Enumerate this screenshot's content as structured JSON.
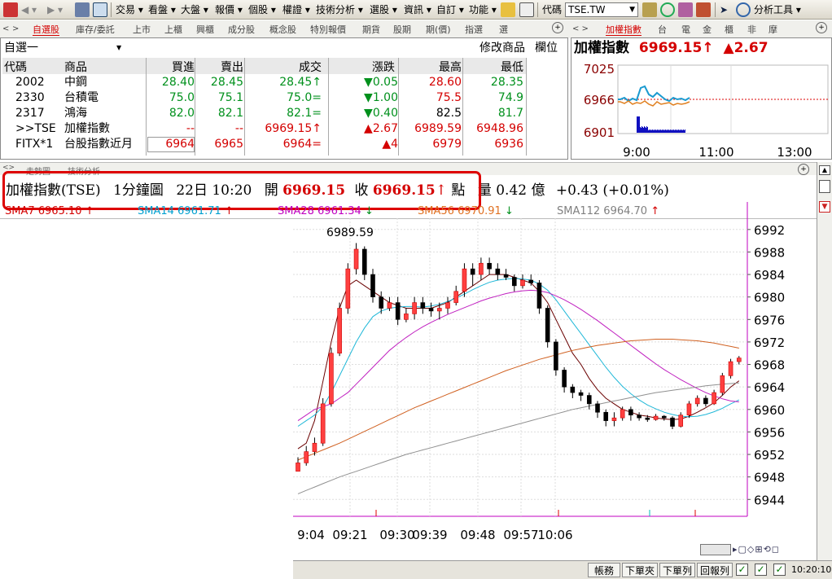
{
  "toolbar": {
    "items": [
      "交易",
      "看盤",
      "大盤",
      "報價",
      "個股",
      "權證",
      "技術分析",
      "選股",
      "資訊",
      "自訂",
      "功能"
    ],
    "code_label": "代碼",
    "code_value": "TSE.TW",
    "analysis_tools": "分析工具"
  },
  "quote_tabs": [
    "自選股",
    "庫存/委託",
    "上市",
    "上櫃",
    "興櫃",
    "成分股",
    "概念股",
    "特別報價",
    "期貨",
    "股期",
    "期(價)",
    "指選",
    "選"
  ],
  "quote_panel": {
    "group": "自選一",
    "modify_label": "修改商品",
    "column_label": "欄位",
    "headers": [
      "代碼",
      "商品",
      "買進",
      "賣出",
      "成交",
      "漲跌",
      "最高",
      "最低"
    ],
    "rows": [
      {
        "code": "2002",
        "name": "中鋼",
        "bid": "28.40",
        "ask": "28.45",
        "last": "28.45",
        "last_mark": "↑",
        "change": "0.05",
        "dir": "down",
        "high": "28.60",
        "low": "28.35",
        "color": "green"
      },
      {
        "code": "2330",
        "name": "台積電",
        "bid": "75.0",
        "ask": "75.1",
        "last": "75.0",
        "last_mark": "=",
        "change": "1.00",
        "dir": "down",
        "high": "75.5",
        "low": "74.9",
        "color": "green"
      },
      {
        "code": "2317",
        "name": "鴻海",
        "bid": "82.0",
        "ask": "82.1",
        "last": "82.1",
        "last_mark": "=",
        "change": "0.40",
        "dir": "down",
        "high": "82.5",
        "low": "81.7",
        "color": "green"
      },
      {
        "code": ">>TSE",
        "name": "加權指數",
        "bid": "--",
        "ask": "--",
        "last": "6969.15",
        "last_mark": "↑",
        "change": "2.67",
        "dir": "up",
        "high": "6989.59",
        "low": "6948.96",
        "color": "red"
      },
      {
        "code": "FITX*1",
        "name": "台股指數近月",
        "bid": "6964",
        "ask": "6965",
        "last": "6964",
        "last_mark": "=",
        "change": "4",
        "dir": "up",
        "high": "6979",
        "low": "6936",
        "color": "red"
      }
    ]
  },
  "mini_tabs": [
    "加權指數",
    "台",
    "電",
    "金",
    "櫃",
    "非",
    "摩"
  ],
  "mini_panel": {
    "title": "加權指數",
    "price": "6969.15",
    "arrow": "↑",
    "change": "▲2.67",
    "y_labels": [
      "7025",
      "6966",
      "6901"
    ],
    "x_labels": [
      "9:00",
      "11:00",
      "13:00"
    ]
  },
  "chart_tabs": [
    "走勢圖",
    "技術分析"
  ],
  "chart_header": {
    "name": "加權指數(TSE)",
    "period": "1分鐘圖",
    "date": "22日",
    "time": "10:20",
    "open_label": "開",
    "open": "6969.15",
    "close_label": "收",
    "close": "6969.15",
    "close_mark": "↑",
    "point_label": "點",
    "vol_label": "量",
    "vol": "0.42",
    "vol_unit": "億",
    "change_pct": "+0.43 (+0.01%)"
  },
  "sma": [
    {
      "name": "SMA7",
      "value": "6965.10",
      "dir": "↑",
      "color": "#d40000"
    },
    {
      "name": "SMA14",
      "value": "6961.71",
      "dir": "↑",
      "color": "#00a0d0"
    },
    {
      "name": "SMA28",
      "value": "6961.34",
      "dir": "↓",
      "color": "#c000c0"
    },
    {
      "name": "SMA56",
      "value": "6970.91",
      "dir": "↓",
      "color": "#e07020"
    },
    {
      "name": "SMA112",
      "value": "6964.70",
      "dir": "↑",
      "color": "#808080"
    }
  ],
  "chart_data": {
    "type": "candlestick",
    "annotation": "6989.59",
    "ylim": [
      6941,
      6994
    ],
    "y_ticks": [
      "6992",
      "6988",
      "6984",
      "6980",
      "6976",
      "6972",
      "6968",
      "6964",
      "6960",
      "6956",
      "6952",
      "6948",
      "6944"
    ],
    "x_ticks": [
      "9:04",
      "09:21",
      "09:30",
      "09:39",
      "09:48",
      "09:57",
      "10:06"
    ],
    "candles": [
      [
        6949.0,
        6950.5,
        6948.96,
        6951.5
      ],
      [
        6950.5,
        6952.5,
        6950.0,
        6953.5
      ],
      [
        6952.5,
        6954.0,
        6951.8,
        6955.0
      ],
      [
        6954.0,
        6961.0,
        6953.5,
        6962.0
      ],
      [
        6961.0,
        6970.0,
        6960.5,
        6971.0
      ],
      [
        6970.0,
        6978.0,
        6969.5,
        6979.0
      ],
      [
        6978.0,
        6985.0,
        6977.0,
        6986.0
      ],
      [
        6985.0,
        6988.5,
        6984.0,
        6989.59
      ],
      [
        6988.5,
        6984.0,
        6983.0,
        6989.0
      ],
      [
        6984.0,
        6980.0,
        6979.0,
        6985.0
      ],
      [
        6980.0,
        6978.0,
        6977.0,
        6981.0
      ],
      [
        6978.0,
        6979.0,
        6977.5,
        6980.0
      ],
      [
        6979.0,
        6976.0,
        6975.0,
        6980.0
      ],
      [
        6976.0,
        6977.0,
        6975.5,
        6978.0
      ],
      [
        6977.0,
        6979.0,
        6976.0,
        6980.0
      ],
      [
        6979.0,
        6978.0,
        6977.0,
        6980.0
      ],
      [
        6978.0,
        6977.5,
        6976.5,
        6979.0
      ],
      [
        6977.5,
        6978.0,
        6976.0,
        6979.0
      ],
      [
        6978.0,
        6979.0,
        6977.0,
        6980.0
      ],
      [
        6979.0,
        6981.0,
        6978.5,
        6982.0
      ],
      [
        6981.0,
        6985.0,
        6980.0,
        6986.0
      ],
      [
        6985.0,
        6984.0,
        6982.0,
        6986.0
      ],
      [
        6984.0,
        6986.0,
        6983.0,
        6987.0
      ],
      [
        6986.0,
        6985.0,
        6984.0,
        6987.0
      ],
      [
        6985.0,
        6984.0,
        6983.0,
        6986.0
      ],
      [
        6984.0,
        6983.5,
        6983.0,
        6985.0
      ],
      [
        6983.5,
        6982.0,
        6981.0,
        6984.0
      ],
      [
        6982.0,
        6983.0,
        6981.5,
        6984.0
      ],
      [
        6983.0,
        6982.5,
        6982.0,
        6984.0
      ],
      [
        6982.5,
        6978.0,
        6977.0,
        6983.0
      ],
      [
        6978.0,
        6972.0,
        6971.0,
        6978.5
      ],
      [
        6972.0,
        6967.0,
        6966.0,
        6972.5
      ],
      [
        6967.0,
        6964.0,
        6963.0,
        6967.5
      ],
      [
        6964.0,
        6963.0,
        6962.0,
        6964.5
      ],
      [
        6963.0,
        6962.5,
        6961.5,
        6963.5
      ],
      [
        6962.5,
        6961.0,
        6960.0,
        6963.0
      ],
      [
        6961.0,
        6959.5,
        6958.5,
        6961.5
      ],
      [
        6959.5,
        6958.0,
        6957.0,
        6960.0
      ],
      [
        6958.0,
        6958.5,
        6957.0,
        6959.5
      ],
      [
        6958.5,
        6960.0,
        6958.0,
        6960.5
      ],
      [
        6960.0,
        6959.0,
        6958.0,
        6960.5
      ],
      [
        6959.0,
        6958.5,
        6958.0,
        6959.5
      ],
      [
        6958.5,
        6958.2,
        6957.8,
        6959.0
      ],
      [
        6958.2,
        6958.8,
        6958.0,
        6959.2
      ],
      [
        6958.8,
        6958.5,
        6958.0,
        6959.0
      ],
      [
        6958.5,
        6957.0,
        6956.5,
        6958.8
      ],
      [
        6957.0,
        6959.0,
        6956.8,
        6959.5
      ],
      [
        6959.0,
        6961.0,
        6958.5,
        6961.5
      ],
      [
        6961.0,
        6962.0,
        6960.5,
        6962.5
      ],
      [
        6962.0,
        6961.0,
        6960.5,
        6962.5
      ],
      [
        6961.0,
        6963.0,
        6960.8,
        6963.5
      ],
      [
        6963.0,
        6966.0,
        6962.5,
        6966.5
      ],
      [
        6966.0,
        6968.5,
        6965.5,
        6969.0
      ],
      [
        6968.5,
        6969.15,
        6968.0,
        6969.5
      ]
    ],
    "sma_curves": {
      "SMA7": [
        6953,
        6954,
        6958,
        6965,
        6972,
        6978,
        6982,
        6983,
        6982,
        6981,
        6980,
        6979,
        6978.5,
        6978,
        6978,
        6978,
        6978,
        6978.5,
        6979,
        6980,
        6981,
        6982,
        6983,
        6984,
        6984,
        6984,
        6983.5,
        6983,
        6982.5,
        6981,
        6979,
        6976,
        6973,
        6970,
        6968,
        6965.5,
        6963.5,
        6962,
        6961,
        6960,
        6959.5,
        6959,
        6958.8,
        6958.5,
        6958.3,
        6958.2,
        6958.3,
        6958.8,
        6959.5,
        6960.3,
        6961.2,
        6962.5,
        6964,
        6965.1
      ],
      "SMA14": [
        6957,
        6958,
        6959,
        6960.5,
        6963,
        6966,
        6969,
        6972,
        6974.5,
        6976.5,
        6977.5,
        6978,
        6978.2,
        6978.3,
        6978.3,
        6978.2,
        6978.4,
        6978.7,
        6979.2,
        6979.8,
        6980.5,
        6981.3,
        6982,
        6982.6,
        6983,
        6983.2,
        6983.3,
        6983.2,
        6983,
        6982.3,
        6981.2,
        6979.5,
        6977.5,
        6975.5,
        6973.5,
        6971.5,
        6969.5,
        6967.5,
        6965.7,
        6964.1,
        6962.8,
        6961.7,
        6960.8,
        6960.1,
        6959.5,
        6959.1,
        6958.8,
        6958.7,
        6958.8,
        6959.1,
        6959.6,
        6960.2,
        6961,
        6961.7
      ],
      "SMA28": [
        6958,
        6959,
        6960,
        6960.5,
        6961,
        6962,
        6963,
        6964.5,
        6966,
        6967.5,
        6969,
        6970.5,
        6971.7,
        6972.8,
        6973.8,
        6974.7,
        6975.5,
        6976.2,
        6976.9,
        6977.5,
        6978.1,
        6978.7,
        6979.3,
        6979.8,
        6980.2,
        6980.6,
        6980.9,
        6981.1,
        6981.2,
        6981.1,
        6980.8,
        6980.2,
        6979.5,
        6978.7,
        6977.8,
        6976.8,
        6975.8,
        6974.7,
        6973.6,
        6972.5,
        6971.4,
        6970.3,
        6969.2,
        6968.1,
        6967.1,
        6966.2,
        6965.3,
        6964.5,
        6963.7,
        6963,
        6962.4,
        6961.9,
        6961.5,
        6961.34
      ],
      "SMA56": [
        6951,
        6951.6,
        6952.2,
        6952.8,
        6953.4,
        6954,
        6954.7,
        6955.4,
        6956.1,
        6956.8,
        6957.5,
        6958.2,
        6958.9,
        6959.6,
        6960.3,
        6960.9,
        6961.5,
        6962.1,
        6962.7,
        6963.3,
        6963.9,
        6964.5,
        6965.1,
        6965.7,
        6966.3,
        6966.9,
        6967.4,
        6967.9,
        6968.4,
        6968.9,
        6969.3,
        6969.7,
        6970.1,
        6970.5,
        6970.8,
        6971.1,
        6971.4,
        6971.6,
        6971.8,
        6972,
        6972.2,
        6972.3,
        6972.4,
        6972.5,
        6972.5,
        6972.5,
        6972.4,
        6972.3,
        6972.2,
        6972,
        6971.8,
        6971.5,
        6971.2,
        6970.91
      ],
      "SMA112": [
        6945,
        6945.6,
        6946.2,
        6946.8,
        6947.4,
        6948,
        6948.5,
        6949,
        6949.5,
        6950,
        6950.5,
        6951,
        6951.5,
        6952,
        6952.4,
        6952.8,
        6953.2,
        6953.6,
        6954,
        6954.4,
        6954.8,
        6955.2,
        6955.6,
        6956,
        6956.4,
        6956.8,
        6957.2,
        6957.6,
        6958,
        6958.4,
        6958.8,
        6959.2,
        6959.6,
        6960,
        6960.3,
        6960.6,
        6960.9,
        6961.2,
        6961.5,
        6961.8,
        6962.1,
        6962.4,
        6962.7,
        6963,
        6963.2,
        6963.4,
        6963.6,
        6963.8,
        6964,
        6964.2,
        6964.35,
        6964.5,
        6964.6,
        6964.7
      ]
    }
  },
  "status_bar": {
    "buttons": [
      "帳務",
      "下單夾",
      "下單列",
      "回報列"
    ],
    "time": "10:20:10"
  }
}
